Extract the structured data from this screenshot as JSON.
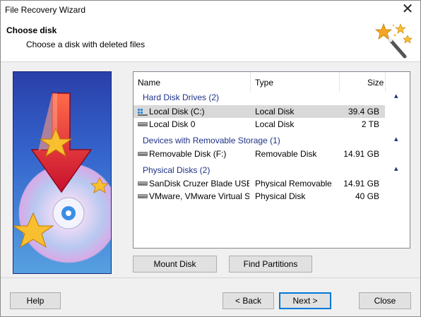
{
  "window": {
    "title": "File Recovery Wizard",
    "close_glyph": "✕"
  },
  "header": {
    "title": "Choose disk",
    "subtitle": "Choose a disk with deleted files",
    "icon": "magic-wand-stars-icon"
  },
  "columns": {
    "name": "Name",
    "type": "Type",
    "size": "Size"
  },
  "groups": [
    {
      "label": "Hard Disk Drives (2)",
      "rows": [
        {
          "name": "Local Disk (C:)",
          "type": "Local Disk",
          "size": "39.4 GB",
          "icon": "windows-drive-icon",
          "selected": true
        },
        {
          "name": "Local Disk 0",
          "type": "Local Disk",
          "size": "2 TB",
          "icon": "hard-drive-icon",
          "selected": false
        }
      ]
    },
    {
      "label": "Devices with Removable Storage (1)",
      "rows": [
        {
          "name": "Removable Disk (F:)",
          "type": "Removable Disk",
          "size": "14.91 GB",
          "icon": "hard-drive-icon",
          "selected": false
        }
      ]
    },
    {
      "label": "Physical Disks (2)",
      "rows": [
        {
          "name": "SanDisk Cruzer Blade USB ...",
          "type": "Physical Removable...",
          "size": "14.91 GB",
          "icon": "hard-drive-icon",
          "selected": false
        },
        {
          "name": "VMware, VMware Virtual S...",
          "type": "Physical Disk",
          "size": "40 GB",
          "icon": "hard-drive-icon",
          "selected": false
        }
      ]
    }
  ],
  "buttons": {
    "mount_disk": "Mount Disk",
    "find_partitions": "Find Partitions",
    "help": "Help",
    "back": "< Back",
    "next": "Next >",
    "close": "Close"
  },
  "colors": {
    "group_text": "#1e3287",
    "selection": "#d9d9d9",
    "default_button_border": "#0078d7"
  }
}
